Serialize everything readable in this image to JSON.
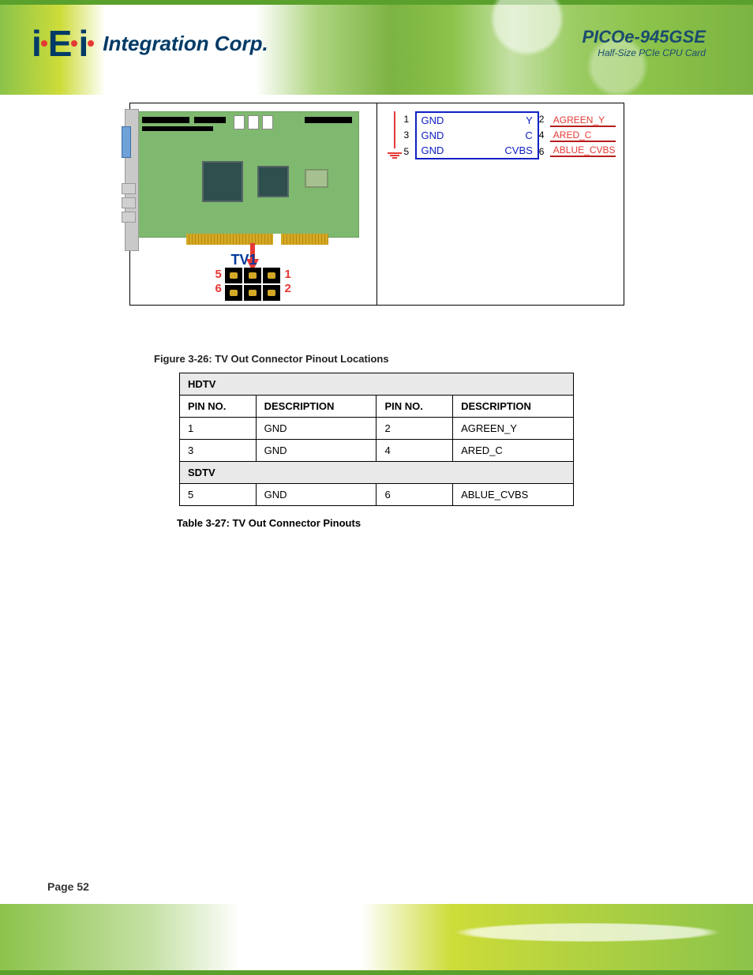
{
  "brand": {
    "logo_alt": "iEi",
    "company": "Integration Corp."
  },
  "header_product": {
    "name": "PICOe-945GSE",
    "subtitle": "Half-Size PCIe CPU Card"
  },
  "figure": {
    "tv_label": "TV1",
    "pin_nums_left": [
      "5",
      "6"
    ],
    "pin_nums_right": [
      "1",
      "2"
    ],
    "caption": "Figure 3-26: TV Out Connector Pinout Locations"
  },
  "schematic": {
    "rows": [
      {
        "ln": "1",
        "l": "GND",
        "r": "Y",
        "rn": "2",
        "sig": "AGREEN_Y"
      },
      {
        "ln": "3",
        "l": "GND",
        "r": "C",
        "rn": "4",
        "sig": "ARED_C"
      },
      {
        "ln": "5",
        "l": "GND",
        "r": "CVBS",
        "rn": "6",
        "sig": "ABLUE_CVBS"
      }
    ]
  },
  "table": {
    "band1": "HDTV",
    "headers": [
      "PIN NO.",
      "DESCRIPTION",
      "PIN NO.",
      "DESCRIPTION"
    ],
    "rows_hdtv": [
      [
        "1",
        "GND",
        "2",
        "AGREEN_Y"
      ],
      [
        "3",
        "GND",
        "4",
        "ARED_C"
      ]
    ],
    "band2": "SDTV",
    "rows_sdtv": [
      [
        "5",
        "GND",
        "6",
        "ABLUE_CVBS"
      ]
    ],
    "caption": "Table 3-27: TV Out Connector Pinouts"
  },
  "page_number": "Page 52"
}
